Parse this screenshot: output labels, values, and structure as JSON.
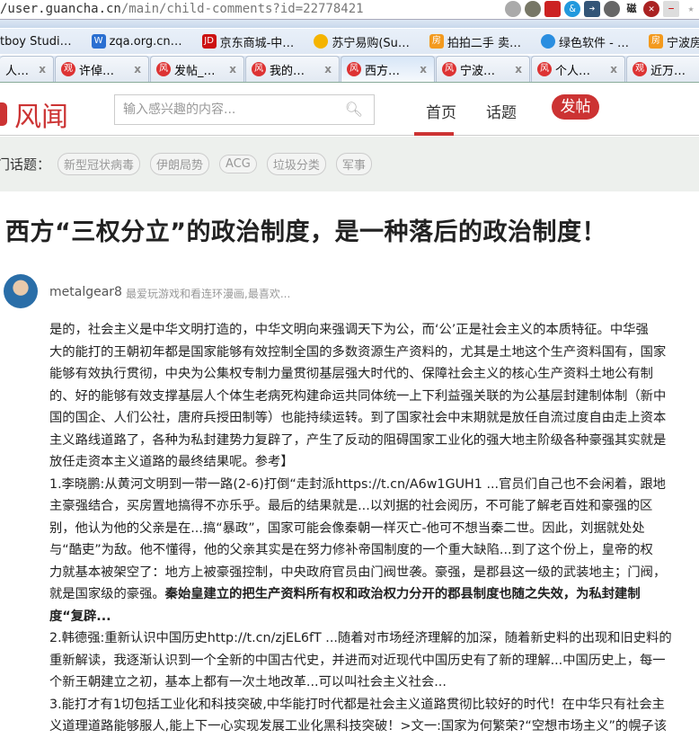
{
  "browser": {
    "url_host": "/user.guancha.cn",
    "url_path": "/main/child-comments?id=22778421",
    "bookmarks": [
      "tboy Studi…",
      "zqa.org.cn…",
      "京东商城-中…",
      "苏宁易购(Su…",
      "拍拍二手 卖…",
      "绿色软件 - …",
      "宁波房地产…"
    ],
    "tabs": [
      {
        "label": "人…"
      },
      {
        "label": "许倬…"
      },
      {
        "label": "发帖_…"
      },
      {
        "label": "我的…"
      },
      {
        "label": "西方…",
        "active": true
      },
      {
        "label": "宁波…"
      },
      {
        "label": "个人…"
      },
      {
        "label": "近万…"
      }
    ],
    "tab_close": "x"
  },
  "site": {
    "logo": "风闻",
    "search_placeholder": "输入感兴趣的内容...",
    "nav_home": "首页",
    "nav_topics": "话题",
    "post_button": "发帖",
    "accent": "#cc3333",
    "hot_label": "门话题：",
    "hot_topics": [
      "新型冠状病毒",
      "伊朗局势",
      "ACG",
      "垃圾分类",
      "军事"
    ]
  },
  "article": {
    "title": "西方“三权分立”的政治制度，是一种落后的政治制度！",
    "author": "metalgear8",
    "bio": "最爱玩游戏和看连环漫画,最喜欢...",
    "lines": [
      "是的，社会主义是中华文明打造的，中华文明向来强调天下为公，而‘公’正是社会主义的本质特征。中华强",
      "大的能打的王朝初年都是国家能够有效控制全国的多数资源生产资料的，尤其是土地这个生产资料国有，国家",
      "能够有效执行贯彻，中央为公集权专制力量贯彻基层强大时代的、保障社会主义的核心生产资料土地公有制",
      "的、好的能够有效支撑基层人个体生老病死构建命运共同体统一上下利益强关联的为公基层封建制体制（新中",
      "国的国企、人们公社，唐府兵授田制等）也能持续运转。到了国家社会中末期就是放任自流过度自由走上资本",
      "主义路线道路了，各种为私封建势力复辟了，产生了反动的阻碍国家工业化的强大地主阶级各种豪强其实就是",
      "放任走资本主义道路的最终结果呢。参考】",
      "1.李晓鹏:从黄河文明到一带一路(2-6)打倒“走封派https://t.cn/A6w1GUH1 ...官员们自己也不会闲着，跟地",
      "主豪强结合，买房置地搞得不亦乐乎。最后的结果就是...以刘据的社会阅历，不可能了解老百姓和豪强的区",
      "别，他认为他的父亲是在...搞“暴政”，国家可能会像秦朝一样灭亡-他可不想当秦二世。因此，刘据就处处",
      "与“酷吏”为敌。他不懂得，他的父亲其实是在努力修补帝国制度的一个重大缺陷...到了这个份上，皇帝的权",
      "力就基本被架空了：地方上被豪强控制，中央政府官员由门阀世袭。豪强，是郡县这一级的武装地主；门阀，"
    ],
    "line12_plain": "就是国家级的豪强。",
    "line12_bold": "秦始皇建立的把生产资料所有权和政治权力分开的郡县制度也随之失效，为私封建制",
    "line13_bold": "度“复辟...",
    "lines2": [
      "2.韩德强:重新认识中国历史http://t.cn/zjEL6fT ...随着对市场经济理解的加深，随着新史料的出现和旧史料的",
      "重新解读，我逐渐认识到一个全新的中国古代史，并进而对近现代中国历史有了新的理解...中国历史上，每一",
      "个新王朝建立之初，基本上都有一次土地改革...可以叫社会主义社会...",
      "3.能打才有1切包括工业化和科技突破,中华能打时代都是社会主义道路贯彻比较好的时代！在中华只有社会主",
      "义道理道路能够服人,能上下一心实现发展工业化黑科技突破！>文一:国家为何繁荣?“空想市场主义”的幌子该"
    ]
  }
}
